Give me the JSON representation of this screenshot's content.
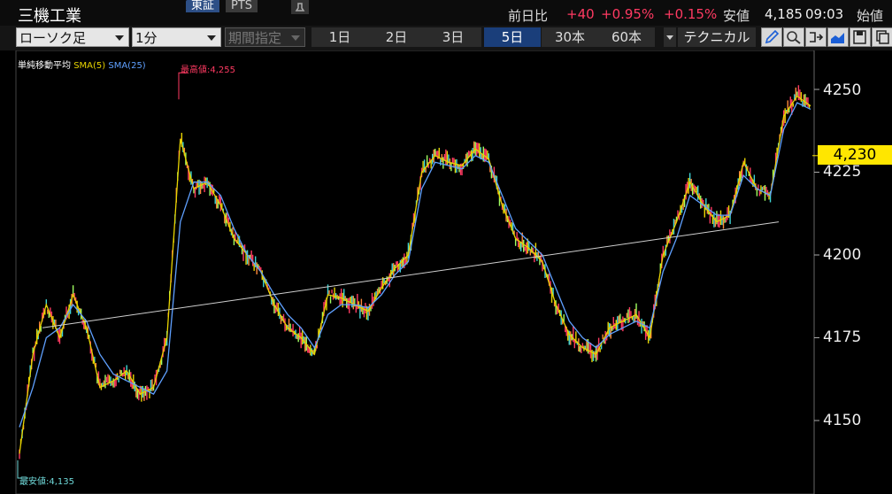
{
  "header": {
    "title": "三機工業",
    "market_tabs": [
      "東証",
      "PTS"
    ],
    "quote": {
      "change_label": "前日比",
      "change_value": "+40",
      "change_pct": "+0.95%",
      "change_pct2": "+0.15%",
      "low_label": "安値",
      "low_value": "4,185",
      "time": "09:03",
      "open_label": "始値"
    }
  },
  "toolbar": {
    "chart_type": "ローソク足",
    "interval": "1分",
    "range_select": "期間指定",
    "periods": [
      "1日",
      "2日",
      "3日",
      "5日",
      "30本",
      "60本"
    ],
    "active_period": "5日",
    "technical_label": "テクニカル"
  },
  "chart": {
    "legend": {
      "title": "単純移動平均",
      "sma5": "SMA(5)",
      "sma25": "SMA(25)"
    },
    "current_price": "4,230",
    "y_ticks": [
      "4250",
      "4225",
      "4200",
      "4175",
      "4150"
    ],
    "high_label": "最高値:4,255",
    "low_label": "最安値:4,135",
    "colors": {
      "up": "#ff3a62",
      "sma5": "#e8d400",
      "sma25": "#5fa0ff",
      "price_tag": "#ffe600",
      "active_tab": "#1a3e7a"
    }
  },
  "chart_data": {
    "type": "line",
    "ylim": [
      4130,
      4262
    ],
    "y_ticks": [
      4250,
      4225,
      4200,
      4175,
      4150
    ],
    "series": [
      {
        "name": "SMA(5)",
        "values": [
          4140,
          4170,
          4185,
          4175,
          4188,
          4178,
          4160,
          4162,
          4165,
          4158,
          4160,
          4175,
          4235,
          4220,
          4222,
          4215,
          4205,
          4200,
          4195,
          4185,
          4178,
          4175,
          4170,
          4188,
          4187,
          4185,
          4183,
          4190,
          4196,
          4200,
          4225,
          4230,
          4228,
          4227,
          4232,
          4229,
          4215,
          4205,
          4202,
          4198,
          4185,
          4176,
          4172,
          4170,
          4178,
          4180,
          4182,
          4175,
          4200,
          4210,
          4222,
          4215,
          4210,
          4212,
          4228,
          4220,
          4218,
          4242,
          4248,
          4245
        ]
      },
      {
        "name": "SMA(25)",
        "values": [
          4148,
          4160,
          4175,
          4178,
          4185,
          4180,
          4170,
          4164,
          4162,
          4160,
          4158,
          4165,
          4210,
          4222,
          4222,
          4218,
          4208,
          4200,
          4195,
          4188,
          4182,
          4178,
          4172,
          4182,
          4185,
          4185,
          4184,
          4188,
          4194,
          4198,
          4220,
          4228,
          4227,
          4226,
          4230,
          4228,
          4218,
          4208,
          4204,
          4200,
          4190,
          4180,
          4175,
          4172,
          4176,
          4178,
          4180,
          4178,
          4195,
          4205,
          4218,
          4215,
          4212,
          4212,
          4224,
          4220,
          4218,
          4238,
          4246,
          4244
        ]
      }
    ],
    "trend_line": {
      "from": 4178,
      "to": 4210
    },
    "current": 4230,
    "high": 4255,
    "low": 4135
  }
}
